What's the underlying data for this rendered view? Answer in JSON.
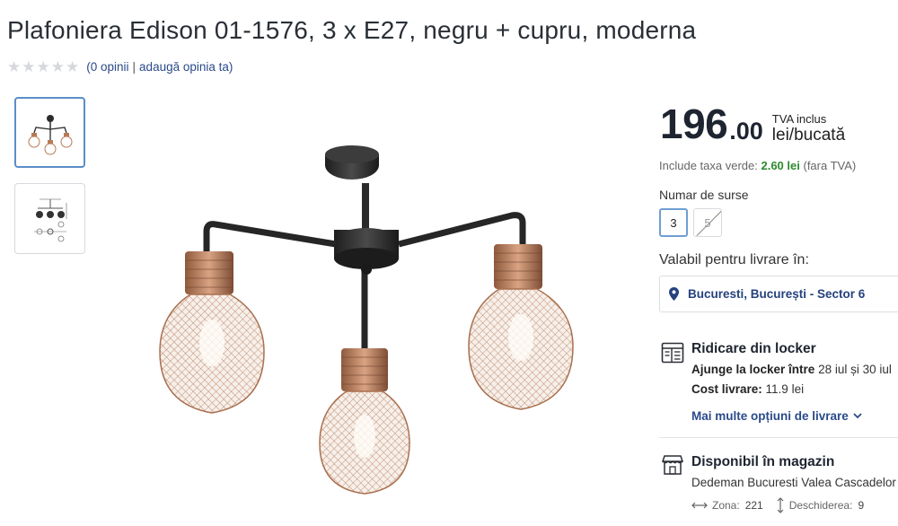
{
  "product": {
    "title": "Plafoniera Edison 01-1576, 3 x E27, negru + cupru, moderna"
  },
  "rating": {
    "stars_filled": 0,
    "stars_total": 5,
    "opinions_link": "(0 opinii",
    "separator": "|",
    "add_opinion_link": "adaugă opinia ta)"
  },
  "gallery": {
    "thumbnails": [
      "lamp-photo",
      "lamp-drawing"
    ]
  },
  "price": {
    "integer": "196",
    "decimals": ".00",
    "vat_label": "TVA inclus",
    "unit_label": "lei/bucată"
  },
  "eco_tax": {
    "prefix": "Include taxa verde:",
    "value": "2.60 lei",
    "suffix": "(fara TVA)"
  },
  "sources": {
    "label": "Numar de surse",
    "options": [
      {
        "label": "3",
        "selected": true,
        "available": true
      },
      {
        "label": "5",
        "selected": false,
        "available": false
      }
    ]
  },
  "delivery": {
    "label": "Valabil pentru livrare în:",
    "location": "Bucuresti, București - Sector 6",
    "locker": {
      "title": "Ridicare din locker",
      "arrives_label": "Ajunge la locker între",
      "arrives_value": "28 iul și 30 iul",
      "cost_label": "Cost livrare:",
      "cost_value": "11.9 lei"
    },
    "more_options_link": "Mai multe opțiuni de livrare"
  },
  "store": {
    "title": "Disponibil în magazin",
    "store_name": "Dedeman Bucuresti Valea Cascadelor (",
    "zone_label": "Zona:",
    "zone_value": "221",
    "aisle_label": "Deschiderea:",
    "aisle_value": "9"
  },
  "colors": {
    "link_blue": "#2a4a8a",
    "eco_green": "#2e8a2e",
    "selected_border": "#6f9ed4",
    "copper": "#b97a56"
  }
}
